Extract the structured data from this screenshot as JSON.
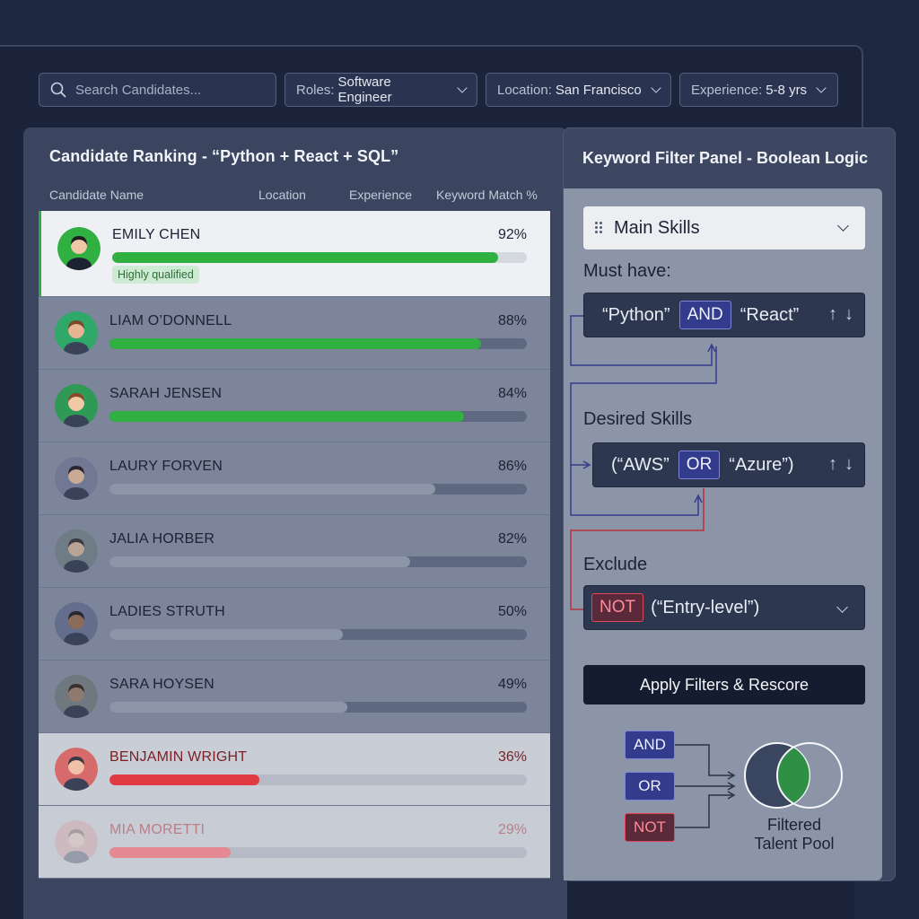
{
  "search": {
    "placeholder": "Search Candidates..."
  },
  "filters": [
    {
      "label": "Roles:",
      "value": "Software Engineer"
    },
    {
      "label": "Location:",
      "value": "San Francisco"
    },
    {
      "label": "Experience:",
      "value": "5-8 yrs"
    }
  ],
  "ranking": {
    "title": "Candidate Ranking - “Python + React + SQL”",
    "columns": [
      "Candidate Name",
      "Location",
      "Experience",
      "Keyword Match %"
    ],
    "candidates": [
      {
        "name": "EMILY CHEN",
        "match": "92%",
        "fill": 0.93,
        "badge": "Highly qualified",
        "color": "#2fb041"
      },
      {
        "name": "LIAM O’DONNELL",
        "match": "88%",
        "fill": 0.89,
        "color": "#2fb041"
      },
      {
        "name": "SARAH JENSEN",
        "match": "84%",
        "fill": 0.85,
        "color": "#2fb041"
      },
      {
        "name": "LAURY FORVEN",
        "match": "86%",
        "fill": 0.78,
        "color": "#8d95a8"
      },
      {
        "name": "JALIA HORBER",
        "match": "82%",
        "fill": 0.72,
        "color": "#8d95a8"
      },
      {
        "name": "LADIES STRUTH",
        "match": "50%",
        "fill": 0.56,
        "color": "#8d95a8"
      },
      {
        "name": "SARA HOYSEN",
        "match": "49%",
        "fill": 0.57,
        "color": "#8d95a8"
      },
      {
        "name": "BENJAMIN WRIGHT",
        "match": "36%",
        "fill": 0.36,
        "color": "#e23a43"
      },
      {
        "name": "MIA MORETTI",
        "match": "29%",
        "fill": 0.29,
        "color": "#e58a93"
      }
    ]
  },
  "keyword_panel": {
    "title": "Keyword Filter Panel - Boolean Logic",
    "group": "Main Skills",
    "must_have": {
      "label": "Must have:",
      "left": "“Python”",
      "op": "AND",
      "right": "“React”"
    },
    "desired": {
      "label": "Desired Skills",
      "left": "(“AWS”",
      "op": "OR",
      "right": "“Azure”)"
    },
    "exclude": {
      "label": "Exclude",
      "op": "NOT",
      "value": "(“Entry-level”)"
    },
    "apply_label": "Apply Filters & Rescore",
    "legend_ops": [
      "AND",
      "OR",
      "NOT"
    ],
    "pool_label_1": "Filtered",
    "pool_label_2": "Talent Pool"
  },
  "icons": {
    "search": "search-icon",
    "dropdown": "chevron-down-icon",
    "move_up": "arrow-up-icon",
    "move_down": "arrow-down-icon",
    "drag": "drag-handle-icon"
  },
  "colors": {
    "match_high": "#2fb041",
    "match_low": "#e23a43",
    "operator": "#333c8c",
    "not_operator": "#e0485a"
  }
}
